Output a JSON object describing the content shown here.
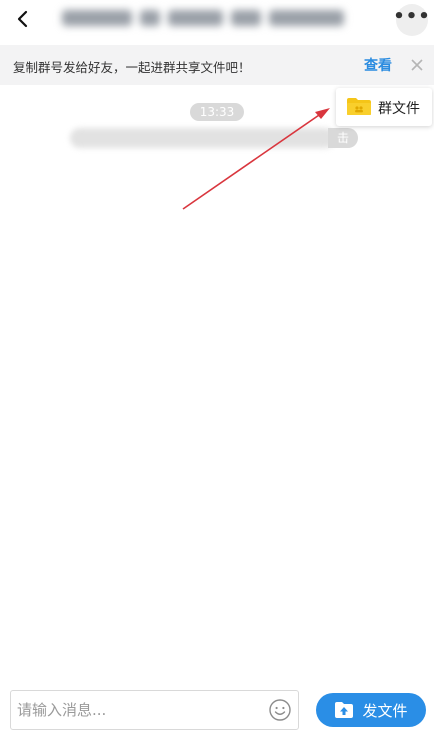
{
  "header": {
    "back_icon": "chevron-left-icon",
    "more_icon": "more-horizontal-icon",
    "more_label": "•••"
  },
  "notice": {
    "text": "复制群号发给好友，一起进群共享文件吧！",
    "view_label": "查看",
    "close_icon": "close-icon"
  },
  "chat": {
    "time": "13:33",
    "system_tail": "击"
  },
  "popup_menu": {
    "icon": "folder-icon",
    "label": "群文件"
  },
  "composer": {
    "placeholder": "请输入消息...",
    "emoji_icon": "smiley-icon",
    "send_file_label": "发文件",
    "send_file_icon": "upload-folder-icon"
  },
  "colors": {
    "accent": "#2a8ee6",
    "link": "#2b8ce0",
    "folder": "#f5c518",
    "arrow": "#d9363e"
  }
}
